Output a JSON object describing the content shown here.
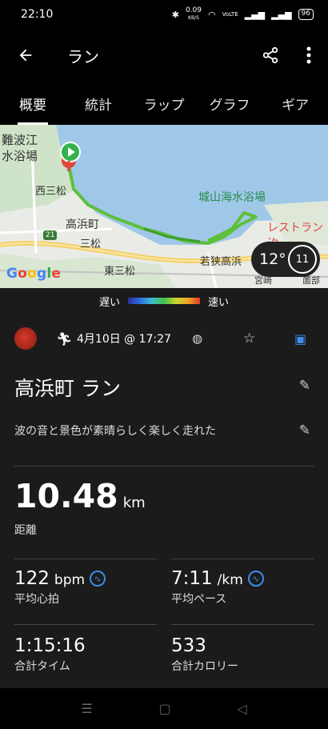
{
  "status": {
    "time": "22:10",
    "speed": "0.09",
    "speed_unit": "KB/S",
    "battery": "96"
  },
  "app_bar": {
    "title": "ラン"
  },
  "tabs": [
    {
      "label": "概要"
    },
    {
      "label": "統計"
    },
    {
      "label": "ラップ"
    },
    {
      "label": "グラフ"
    },
    {
      "label": "ギア"
    }
  ],
  "map": {
    "labels": {
      "nanbae": "難波江",
      "swim_left": "水浴場",
      "nishimitsumatsu": "西三松",
      "shiroyama": "城山海水浴場",
      "takahama": "高浜町",
      "restaurant": "レストラン汐",
      "mitsumatsu": "三松",
      "route21": "21",
      "higashimitsumatsu": "東三松",
      "wakasa": "若狭高浜",
      "miyazaki": "宮崎",
      "sonobe": "薗部"
    },
    "google": "Google",
    "weather": {
      "temp": "12°",
      "uv": "11"
    }
  },
  "legend": {
    "slow": "遅い",
    "fast": "速い"
  },
  "activity": {
    "date": "4月10日 @ 17:27",
    "title": "高浜町 ラン",
    "description": "波の音と景色が素晴らしく楽しく走れた",
    "distance": {
      "value": "10.48",
      "unit": "km",
      "label": "距離"
    },
    "stats": {
      "hr": {
        "value": "122",
        "unit": "bpm",
        "label": "平均心拍"
      },
      "pace": {
        "value": "7:11",
        "unit": "/km",
        "label": "平均ペース"
      },
      "time": {
        "value": "1:15:16",
        "label": "合計タイム"
      },
      "calories": {
        "value": "533",
        "label": "合計カロリー"
      }
    }
  },
  "colors": {
    "accent_blue": "#3d8de8",
    "route_green": "#5fbf3a",
    "background": "#1b1b1b"
  }
}
